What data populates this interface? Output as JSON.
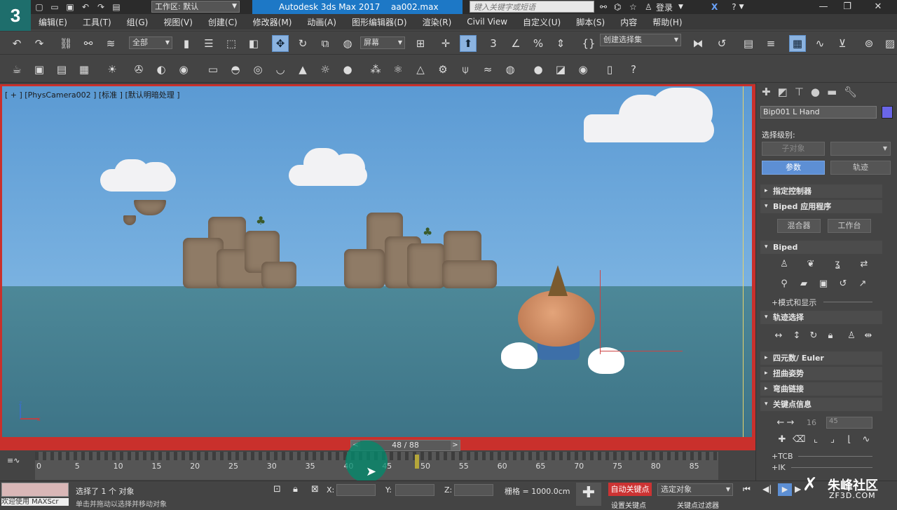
{
  "app": {
    "logo": "3",
    "title": "Autodesk 3ds Max 2017",
    "file": "aa002.max"
  },
  "titlebar": {
    "workspace_label": "工作区: 默认",
    "search_placeholder": "键入关键字或短语",
    "login": "登录"
  },
  "menu": [
    "编辑(E)",
    "工具(T)",
    "组(G)",
    "视图(V)",
    "创建(C)",
    "修改器(M)",
    "动画(A)",
    "图形编辑器(D)",
    "渲染(R)",
    "Civil View",
    "自定义(U)",
    "脚本(S)",
    "内容",
    "帮助(H)"
  ],
  "toolbar": {
    "filter": "全部",
    "coord": "屏幕",
    "selection_set": "创建选择集"
  },
  "viewport": {
    "label": "[ + ] [PhysCamera002 ] [标准 ] [默认明暗处理 ]"
  },
  "timeline": {
    "frame_display": "48 / 88",
    "prev": "<",
    "next": ">",
    "ticks": [
      "0",
      "5",
      "10",
      "15",
      "20",
      "25",
      "30",
      "35",
      "40",
      "45",
      "50",
      "55",
      "60",
      "65",
      "70",
      "75",
      "80",
      "85"
    ]
  },
  "status": {
    "selection": "选择了 1 个 对象",
    "x_label": "X:",
    "y_label": "Y:",
    "z_label": "Z:",
    "grid": "栅格 = 1000.0cm",
    "autokey": "自动关键点",
    "set_key": "设置关键点",
    "sel_obj": "选定对象",
    "key_filter": "关键点过滤器",
    "maxscript_text": "欢迎使用 MAXScr",
    "prompt_text": "单击并拖动以选择并移动对象"
  },
  "panel": {
    "object_name": "Bip001 L Hand",
    "select_level_label": "选择级别:",
    "sub_object": "子对象",
    "tab_params": "参数",
    "tab_track": "轨迹",
    "rollouts": {
      "assign": "指定控制器",
      "biped_apps": "Biped 应用程序",
      "biped": "Biped",
      "track_sel": "轨迹选择",
      "quat": "四元数/ Euler",
      "twist": "扭曲姿势",
      "bend": "弯曲链接",
      "keyinfo": "关键点信息"
    },
    "mixer": "混合器",
    "workbench": "工作台",
    "mode_display": "+模式和显示",
    "key_num": "16",
    "key_val": "45",
    "tcb": "+TCB",
    "ik": "+IK"
  },
  "watermark": {
    "brand": "朱峰社区",
    "site": "ZF3D.COM"
  },
  "colors": {
    "accent": "#1d78c6",
    "vp_border": "#c9302c",
    "object_color": "#6a66e8"
  }
}
